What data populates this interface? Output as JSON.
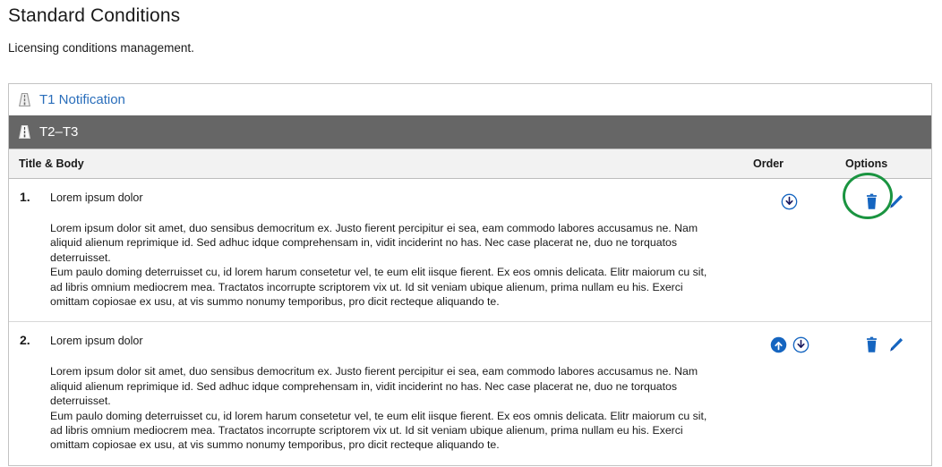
{
  "page": {
    "title": "Standard Conditions",
    "subtitle": "Licensing conditions management."
  },
  "accordion": {
    "items": [
      {
        "label": "T1 Notification",
        "icon": "road-icon",
        "state": "collapsed"
      },
      {
        "label": "T2–T3",
        "icon": "road-icon",
        "state": "expanded"
      }
    ]
  },
  "table": {
    "headers": {
      "title_body": "Title & Body",
      "order": "Order",
      "options": "Options"
    },
    "rows": [
      {
        "number": "1.",
        "title": "Lorem ipsum dolor",
        "paragraphs": [
          "Lorem ipsum dolor sit amet, duo sensibus democritum ex. Justo fierent percipitur ei sea, eam commodo labores accusamus ne. Nam aliquid alienum reprimique id. Sed adhuc idque comprehensam in, vidit inciderint no has. Nec case placerat ne, duo ne torquatos deterruisset.",
          "Eum paulo doming deterruisset cu, id lorem harum consetetur vel, te eum elit iisque fierent. Ex eos omnis delicata. Elitr maiorum cu sit, ad libris omnium mediocrem mea. Tractatos incorrupte scriptorem vix ut. Id sit veniam ubique alienum, prima nullam eu his. Exerci omittam copiosae ex usu, at vis summo nonumy temporibus, pro dicit recteque aliquando te."
        ],
        "order_icons": [
          "move-down-icon"
        ],
        "option_icons": [
          "delete-icon",
          "edit-icon"
        ],
        "annotated": true
      },
      {
        "number": "2.",
        "title": "Lorem ipsum dolor",
        "paragraphs": [
          "Lorem ipsum dolor sit amet, duo sensibus democritum ex. Justo fierent percipitur ei sea, eam commodo labores accusamus ne. Nam aliquid alienum reprimique id. Sed adhuc idque comprehensam in, vidit inciderint no has. Nec case placerat ne, duo ne torquatos deterruisset.",
          "Eum paulo doming deterruisset cu, id lorem harum consetetur vel, te eum elit iisque fierent. Ex eos omnis delicata. Elitr maiorum cu sit, ad libris omnium mediocrem mea. Tractatos incorrupte scriptorem vix ut. Id sit veniam ubique alienum, prima nullam eu his. Exerci omittam copiosae ex usu, at vis summo nonumy temporibus, pro dicit recteque aliquando te."
        ],
        "order_icons": [
          "move-up-icon",
          "move-down-icon"
        ],
        "option_icons": [
          "delete-icon",
          "edit-icon"
        ],
        "annotated": false
      }
    ]
  },
  "colors": {
    "link": "#2a6ebb",
    "active_header_bg": "#666666",
    "table_header_bg": "#f2f2f2",
    "icon_blue": "#1565c0",
    "annotation_green": "#1a9440"
  }
}
